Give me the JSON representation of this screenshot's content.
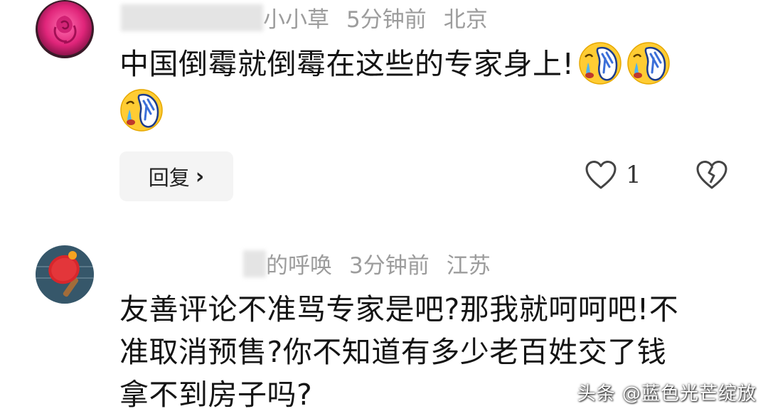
{
  "comments": [
    {
      "username_visible": "小小草",
      "time": "5分钟前",
      "location": "北京",
      "text": "中国倒霉就倒霉在这些的专家身上!",
      "reply_label": "回复",
      "like_count": "1",
      "icons": {
        "avatar": "rose-avatar",
        "emoji": "crying-face-slipper-emoji",
        "like": "heart-icon",
        "dislike": "broken-heart-icon"
      }
    },
    {
      "username_visible": "的呼唤",
      "time": "3分钟前",
      "location": "江苏",
      "text_lines": [
        "友善评论不准骂专家是吧?那我就呵呵吧!不",
        "准取消预售?你不知道有多少老百姓交了钱",
        "拿不到房子吗?"
      ],
      "icons": {
        "avatar": "ping-pong-paddle-avatar"
      }
    }
  ],
  "watermark": "头条 @蓝色光芒绽放",
  "colors": {
    "meta_text": "#9c9c9c",
    "body_text": "#141414",
    "reply_bg": "#f4f4f4",
    "avatar_rose": "#e0257a",
    "avatar_paddle_bg": "#3d5f74",
    "paddle_red": "#d8262b",
    "ball_orange": "#f5a321"
  }
}
